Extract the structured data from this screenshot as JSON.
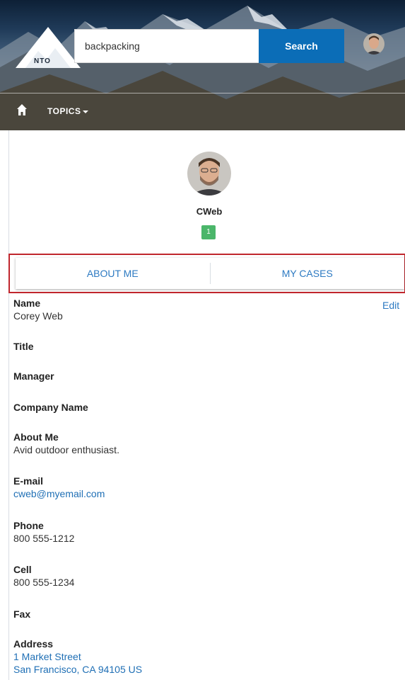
{
  "header": {
    "logo_text": "NTO",
    "search": {
      "value": "backpacking",
      "button_label": "Search"
    },
    "nav": {
      "topics_label": "TOPICS"
    }
  },
  "profile": {
    "nickname": "CWeb",
    "reputation_count": "1"
  },
  "tabs": [
    {
      "label": "ABOUT ME"
    },
    {
      "label": "MY CASES"
    }
  ],
  "details": {
    "edit_label": "Edit",
    "fields": [
      {
        "label": "Name",
        "values": [
          "Corey Web"
        ]
      },
      {
        "label": "Title",
        "values": []
      },
      {
        "label": "Manager",
        "values": []
      },
      {
        "label": "Company Name",
        "values": []
      },
      {
        "label": "About Me",
        "values": [
          "Avid outdoor enthusiast."
        ]
      },
      {
        "label": "E-mail",
        "values": [
          "cweb@myemail.com"
        ]
      },
      {
        "label": "Phone",
        "values": [
          "800 555-1212"
        ]
      },
      {
        "label": "Cell",
        "values": [
          "800 555-1234"
        ]
      },
      {
        "label": "Fax",
        "values": []
      },
      {
        "label": "Address",
        "values": [
          "1 Market Street",
          "San Francisco, CA 94105 US"
        ]
      }
    ]
  },
  "colors": {
    "accent": "#0b6db7",
    "link": "#2d7ac2",
    "badge": "#4bb66a",
    "tab_highlight": "#c0262d"
  }
}
